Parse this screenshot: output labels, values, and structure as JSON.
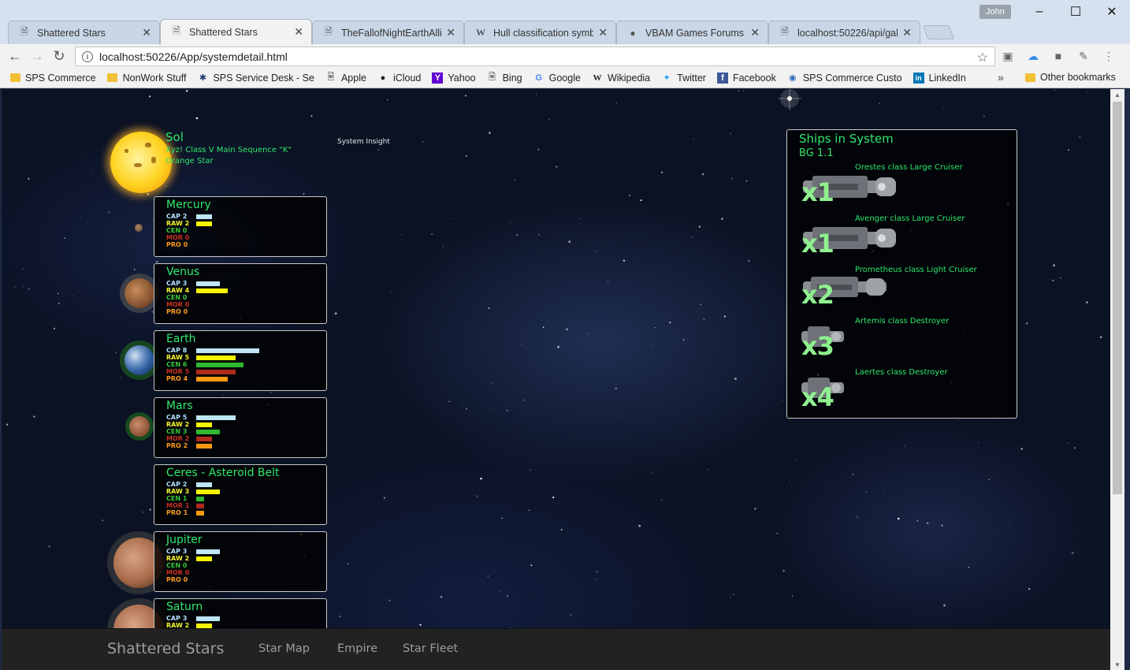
{
  "browser": {
    "profile": "John",
    "tabs": [
      {
        "title": "Shattered Stars",
        "icon": "page-icon",
        "active": false
      },
      {
        "title": "Shattered Stars",
        "icon": "page-icon",
        "active": true
      },
      {
        "title": "TheFallofNightEarthAlliar",
        "icon": "page-icon",
        "active": false
      },
      {
        "title": "Hull classification symbo",
        "icon": "wikipedia-icon",
        "active": false
      },
      {
        "title": "VBAM Games Forums - F",
        "icon": "forum-icon",
        "active": false
      },
      {
        "title": "localhost:50226/api/gala",
        "icon": "page-icon",
        "active": false
      }
    ],
    "url": "localhost:50226/App/systemdetail.html",
    "bookmarks": [
      {
        "label": "SPS Commerce",
        "icon": "folder-icon"
      },
      {
        "label": "NonWork Stuff",
        "icon": "folder-icon"
      },
      {
        "label": "SPS Service Desk - Se",
        "icon": "service-desk-icon"
      },
      {
        "label": "Apple",
        "icon": "page-icon"
      },
      {
        "label": "iCloud",
        "icon": "apple-icon"
      },
      {
        "label": "Yahoo",
        "icon": "yahoo-icon"
      },
      {
        "label": "Bing",
        "icon": "page-icon"
      },
      {
        "label": "Google",
        "icon": "google-icon"
      },
      {
        "label": "Wikipedia",
        "icon": "wikipedia-icon"
      },
      {
        "label": "Twitter",
        "icon": "twitter-icon"
      },
      {
        "label": "Facebook",
        "icon": "facebook-icon"
      },
      {
        "label": "SPS Commerce Custo",
        "icon": "sps-icon"
      },
      {
        "label": "LinkedIn",
        "icon": "linkedin-icon"
      }
    ],
    "other_bookmarks": "Other bookmarks",
    "more_glyph": "»"
  },
  "system": {
    "star_name": "Sol",
    "star_desc": "Xyz! Class V Main Sequence \"K\" Orange Star",
    "insight_link": "System Insight"
  },
  "stat_labels": {
    "cap": "CAP",
    "raw": "RAW",
    "cen": "CEN",
    "mor": "MOR",
    "pro": "PRO"
  },
  "planets": [
    {
      "name": "Mercury",
      "cap": 2,
      "raw": 2,
      "cen": 0,
      "mor": 0,
      "pro": 0
    },
    {
      "name": "Venus",
      "cap": 3,
      "raw": 4,
      "cen": 0,
      "mor": 0,
      "pro": 0
    },
    {
      "name": "Earth",
      "cap": 8,
      "raw": 5,
      "cen": 6,
      "mor": 5,
      "pro": 4
    },
    {
      "name": "Mars",
      "cap": 5,
      "raw": 2,
      "cen": 3,
      "mor": 2,
      "pro": 2
    },
    {
      "name": "Ceres - Asteroid Belt",
      "cap": 2,
      "raw": 3,
      "cen": 1,
      "mor": 1,
      "pro": 1
    },
    {
      "name": "Jupiter",
      "cap": 3,
      "raw": 2,
      "cen": 0,
      "mor": 0,
      "pro": 0
    },
    {
      "name": "Saturn",
      "cap": 3,
      "raw": 2
    }
  ],
  "ships_panel": {
    "title": "Ships in System",
    "fleet": "BG 1.1",
    "ships": [
      {
        "count": "x1",
        "class": "Orestes class Large Cruiser"
      },
      {
        "count": "x1",
        "class": "Avenger class Large Cruiser"
      },
      {
        "count": "x2",
        "class": "Prometheus class Light Cruiser"
      },
      {
        "count": "x3",
        "class": "Artemis class Destroyer"
      },
      {
        "count": "x4",
        "class": "Laertes class Destroyer"
      }
    ]
  },
  "app_nav": {
    "brand": "Shattered Stars",
    "links": [
      "Star Map",
      "Empire",
      "Star Fleet"
    ]
  },
  "colors": {
    "neon_text": "#2ee86b",
    "cap": "#bfe6f7",
    "raw": "#f5f500",
    "cen": "#2fb92f",
    "mor": "#b02a1c",
    "pro": "#ff9a10"
  }
}
